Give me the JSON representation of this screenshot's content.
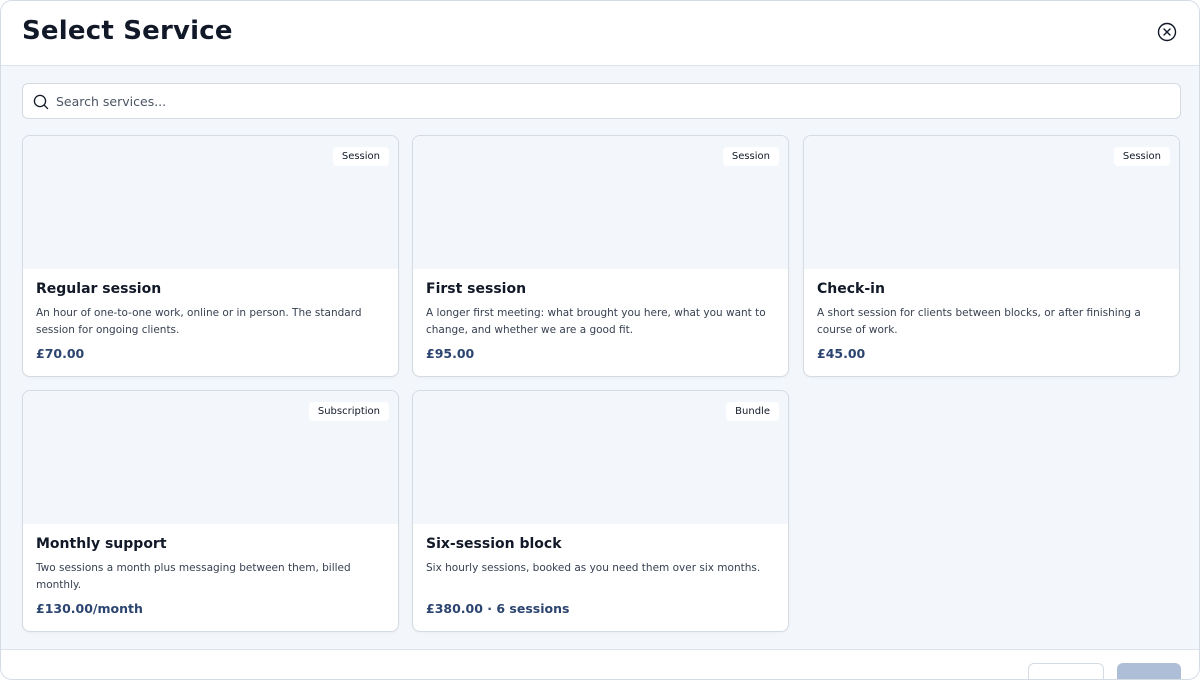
{
  "modal": {
    "title": "Select Service"
  },
  "search": {
    "placeholder": "Search services..."
  },
  "services": [
    {
      "badge": "Session",
      "title": "Regular session",
      "description": "An hour of one-to-one work, online or in person. The standard session for ongoing clients.",
      "price": "£70.00"
    },
    {
      "badge": "Session",
      "title": "First session",
      "description": "A longer first meeting: what brought you here, what you want to change, and whether we are a good fit.",
      "price": "£95.00"
    },
    {
      "badge": "Session",
      "title": "Check-in",
      "description": "A short session for clients between blocks, or after finishing a course of work.",
      "price": "£45.00"
    },
    {
      "badge": "Subscription",
      "title": "Monthly support",
      "description": "Two sessions a month plus messaging between them, billed monthly.",
      "price": "£130.00/month"
    },
    {
      "badge": "Bundle",
      "title": "Six-session block",
      "description": "Six hourly sessions, booked as you need them over six months.",
      "price": "£380.00 · 6 sessions"
    }
  ],
  "icons": {
    "close": "close-circle-icon",
    "search": "search-icon"
  }
}
